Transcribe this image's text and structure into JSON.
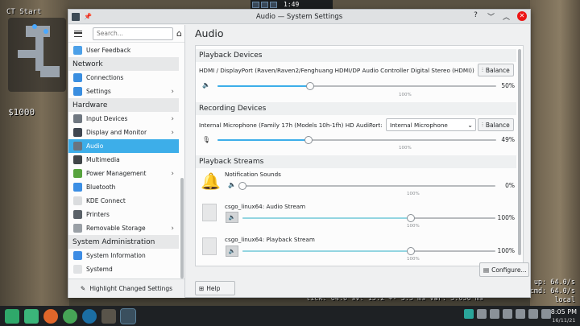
{
  "game": {
    "ct_start": "CT Start",
    "money": "$1000",
    "net_line": "tick: 64.0  sv: 15.2 +- 3.3 ms  var: 3.050 ms",
    "up": "up: 64.0/s",
    "cmd": "cmd: 64.0/s",
    "local": "local"
  },
  "topbar": {
    "clock": "1:49"
  },
  "window": {
    "title": "Audio — System Settings",
    "controls": [
      "?",
      "﹀",
      "︿",
      "✕"
    ]
  },
  "sidebar": {
    "search_placeholder": "Search...",
    "items": [
      {
        "label": "User Feedback",
        "color": "#4ca0e8"
      },
      {
        "category": "Network"
      },
      {
        "label": "Connections",
        "color": "#3a8ee0"
      },
      {
        "label": "Settings",
        "color": "#3a8ee0",
        "chevron": true
      },
      {
        "category": "Hardware"
      },
      {
        "label": "Input Devices",
        "color": "#6f7780",
        "chevron": true
      },
      {
        "label": "Display and Monitor",
        "color": "#3f4650",
        "chevron": true
      },
      {
        "label": "Audio",
        "color": "#6a7480",
        "active": true
      },
      {
        "label": "Multimedia",
        "color": "#404548"
      },
      {
        "label": "Power Management",
        "color": "#57a33d",
        "chevron": true
      },
      {
        "label": "Bluetooth",
        "color": "#3b8ee4"
      },
      {
        "label": "KDE Connect",
        "color": "#dadcde"
      },
      {
        "label": "Printers",
        "color": "#5a6168"
      },
      {
        "label": "Removable Storage",
        "color": "#9aa0a6",
        "chevron": true
      },
      {
        "category": "System Administration"
      },
      {
        "label": "System Information",
        "color": "#3d8ce4"
      },
      {
        "label": "Systemd",
        "color": "#e0e2e4"
      }
    ],
    "highlight_label": "Highlight Changed Settings"
  },
  "page_title": "Audio",
  "playback_devices": {
    "heading": "Playback Devices",
    "device_name": "HDMI / DisplayPort (Raven/Raven2/Fenghuang HDMI/DP Audio Controller Digital Stereo (HDMI))",
    "balance_label": "Balance",
    "volume": 50,
    "volume_label": "50%",
    "tick_label": "100%"
  },
  "recording_devices": {
    "heading": "Recording Devices",
    "device_name": "Internal Microphone (Family 17h (Models 10h-1fh) HD Audi...",
    "port_label": "Port:",
    "port_value": "Internal Microphone",
    "balance_label": "Balance",
    "volume": 49,
    "volume_label": "49%",
    "tick_label": "100%"
  },
  "playback_streams": {
    "heading": "Playback Streams",
    "streams": [
      {
        "name": "Notification Sounds",
        "volume": 0,
        "volume_label": "0%",
        "tick_label": "100%"
      },
      {
        "name": "csgo_linux64: Audio Stream",
        "volume": 100,
        "volume_label": "100%",
        "tick_label": "100%"
      },
      {
        "name": "csgo_linux64: Playback Stream",
        "volume": 100,
        "volume_label": "100%",
        "tick_label": "100%"
      }
    ]
  },
  "buttons": {
    "help": "Help",
    "configure": "Configure..."
  },
  "taskbar": {
    "time": "8:05 PM",
    "date": "16/11/21"
  }
}
